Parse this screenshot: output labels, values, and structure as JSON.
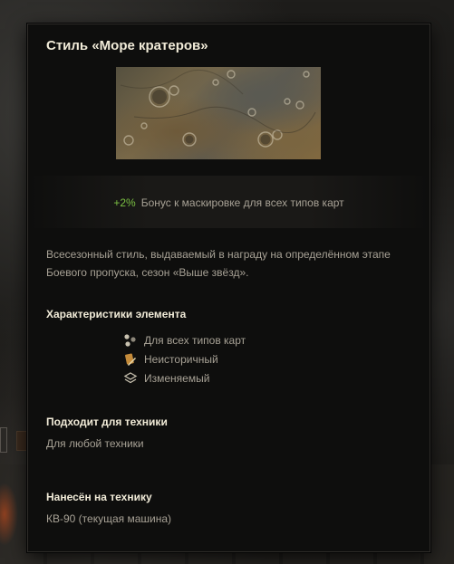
{
  "tooltip": {
    "title": "Стиль «Море кратеров»",
    "bonus": {
      "value": "+2%",
      "text": "Бонус к маскировке для всех типов карт",
      "value_color": "#7bc043"
    },
    "description": "Всесезонный стиль, выдаваемый в награду на определённом этапе Боевого пропуска, сезон «Выше звёзд».",
    "characteristics": {
      "title": "Характеристики элемента",
      "items": [
        {
          "icon": "all-maps-icon",
          "label": "Для всех типов карт"
        },
        {
          "icon": "non-historical-icon",
          "label": "Неисторичный"
        },
        {
          "icon": "layers-icon",
          "label": "Изменяемый"
        }
      ]
    },
    "suitable": {
      "title": "Подходит для техники",
      "text": "Для любой техники"
    },
    "applied": {
      "title": "Нанесён на технику",
      "text": "КВ-90 (текущая машина)"
    }
  },
  "colors": {
    "title": "#f1ebd8",
    "text": "#a7a195",
    "bonus": "#7bc043",
    "panel": "#0e0e0d"
  }
}
